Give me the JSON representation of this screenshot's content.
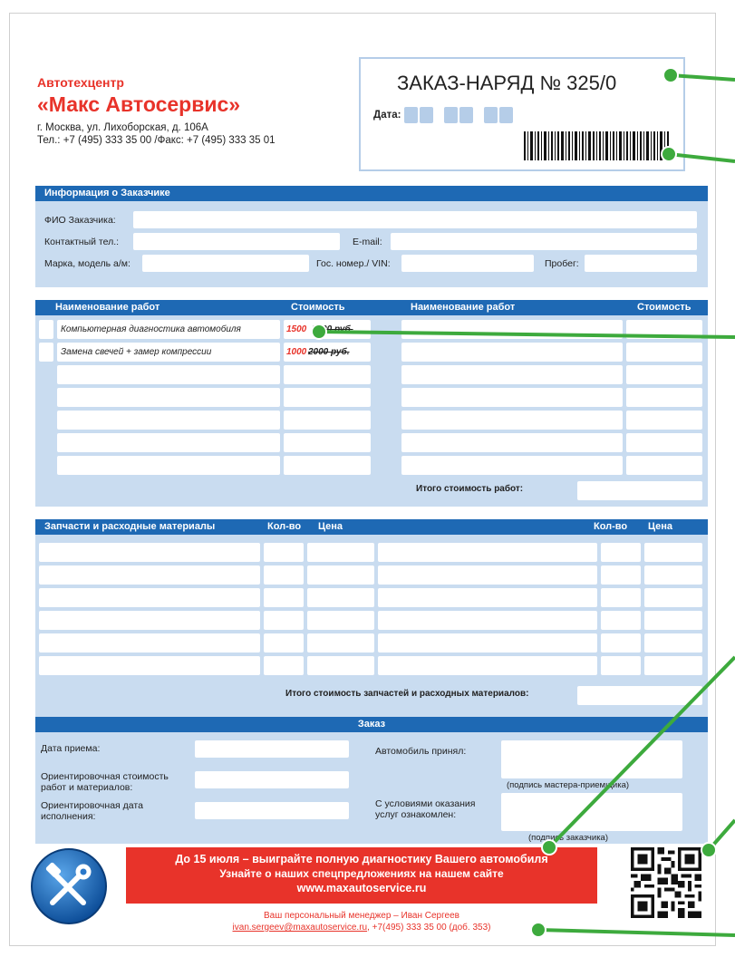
{
  "company": {
    "subtitle": "Автотехцентр",
    "name": "«Макс Автосервис»",
    "address": "г. Москва, ул. Лихоборская,  д. 106А",
    "phones": "Тел.: +7 (495) 333 35 00 /Факс: +7 (495) 333 35 01"
  },
  "order": {
    "title": "ЗАКАЗ-НАРЯД № 325/0",
    "date_label": "Дата:"
  },
  "customer": {
    "header": "Информация о Заказчике",
    "name_label": "ФИО Заказчика:",
    "phone_label": "Контактный тел.:",
    "email_label": "E-mail:",
    "car_label": "Марка, модель а/м:",
    "plate_label": "Гос. номер./ VIN:",
    "mileage_label": "Пробег:"
  },
  "works": {
    "col_name": "Наименование работ",
    "col_price": "Стоимость",
    "col_name_2": "Наименование работ",
    "col_price_2": "Стоимость",
    "rows": [
      {
        "name": "Компьютерная диагностика автомобиля",
        "price": "1500",
        "old_price": "2000 руб."
      },
      {
        "name": "Замена свечей + замер компрессии",
        "price": "1000",
        "old_price": "2000 руб."
      }
    ],
    "total_label": "Итого стоимость работ:"
  },
  "parts": {
    "col_name": "Запчасти и расходные материалы",
    "col_qty": "Кол-во",
    "col_price": "Цена",
    "col_qty_2": "Кол-во",
    "col_price_2": "Цена",
    "total_label": "Итого стоимость запчастей и расходных материалов:"
  },
  "order_info": {
    "header": "Заказ",
    "received_date": "Дата приема:",
    "estimated_cost": "Ориентировочная стоимость работ и материалов:",
    "estimated_date": "Ориентировочная дата исполнения:",
    "car_accepted": "Автомобиль принял:",
    "master_sign": "(подпись мастера-приемщика)",
    "terms_agreed": "С условиями оказания услуг ознакомлен:",
    "customer_sign": "(подпись заказчика)"
  },
  "promo": {
    "line1": "До 15  июля – выиграйте полную диагностику Вашего автомобиля",
    "line2": "Узнайте о наших спецпредложениях на нашем сайте",
    "line3": "www.maxautoservice.ru"
  },
  "manager": {
    "line1": "Ваш персональный менеджер – Иван Сергеев",
    "email": "ivan.sergeev@maxautoservice.ru",
    "phone": ", +7(495) 333 35 00 (доб. 353)"
  },
  "colors": {
    "accent_blue": "#1e69b4",
    "light_blue": "#c9dcf0",
    "brand_red": "#e8332a",
    "callout_green": "#3daa3d"
  },
  "icons": [
    "tools-logo-icon",
    "qr-code-icon",
    "barcode-icon"
  ]
}
